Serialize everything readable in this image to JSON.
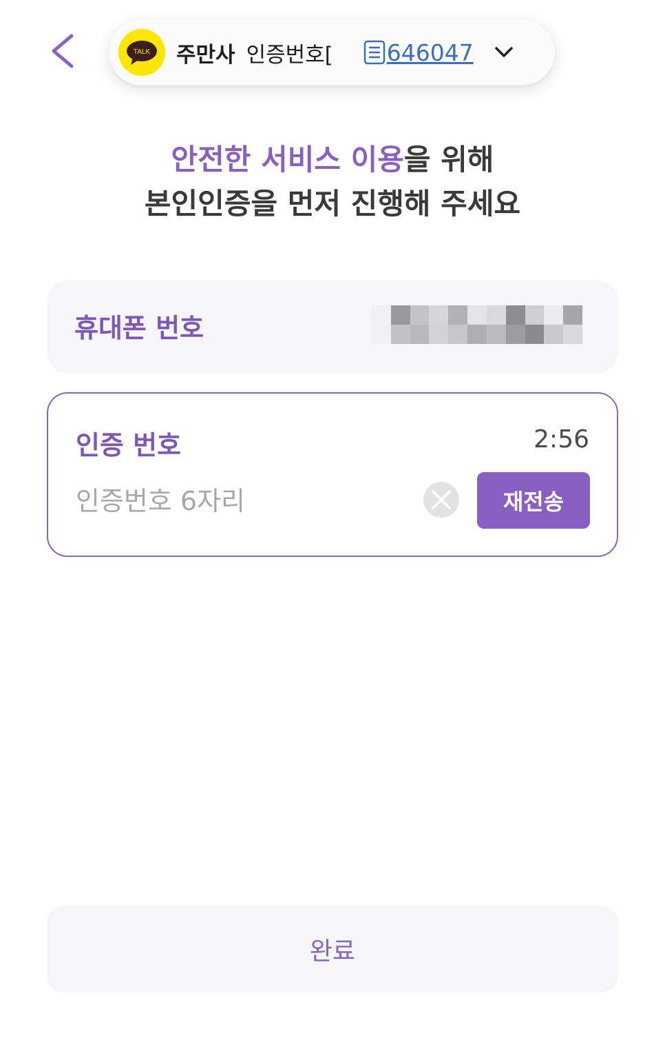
{
  "notification": {
    "app_icon": "kakaotalk-logo-icon",
    "app_icon_text": "TALK",
    "sender": "주만사",
    "preview": "인증번호[",
    "copy_icon": "copy-icon",
    "code": "646047",
    "expand_icon": "chevron-down-icon"
  },
  "nav": {
    "back_icon": "chevron-left-icon"
  },
  "headline": {
    "highlight": "안전한 서비스 이용",
    "line1_rest": "을 위해",
    "line2": "본인인증을 먼저 진행해 주세요"
  },
  "phone": {
    "label": "휴대폰 번호",
    "value_state": "redacted-pixelated"
  },
  "verification": {
    "label": "인증 번호",
    "timer": "2:56",
    "input_value": "",
    "input_placeholder": "인증번호 6자리",
    "clear_icon": "clear-circle-x-icon",
    "resend_label": "재전송"
  },
  "submit": {
    "label": "완료"
  },
  "colors": {
    "accent": "#8a5fc4",
    "accent_text": "#7e56b6",
    "kakao_yellow": "#FEE500",
    "link_blue": "#3b6fb6",
    "card_bg": "#f6f6f9"
  }
}
